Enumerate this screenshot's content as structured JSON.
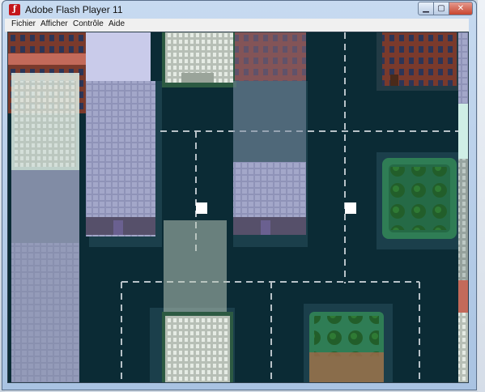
{
  "window": {
    "title": "Adobe Flash Player 11",
    "icon": "flash-icon",
    "controls": {
      "minimize": "minimize-icon",
      "maximize": "maximize-icon",
      "close": "close-icon"
    }
  },
  "menu": {
    "items": [
      "Fichier",
      "Afficher",
      "Contrôle",
      "Aide"
    ]
  },
  "game": {
    "scene": "top-down city streets",
    "colors": {
      "road": "#0b2b35",
      "lane_marking": "#b8c2c8",
      "player_marker": "#ffffff",
      "park": "#2f7d55"
    }
  }
}
